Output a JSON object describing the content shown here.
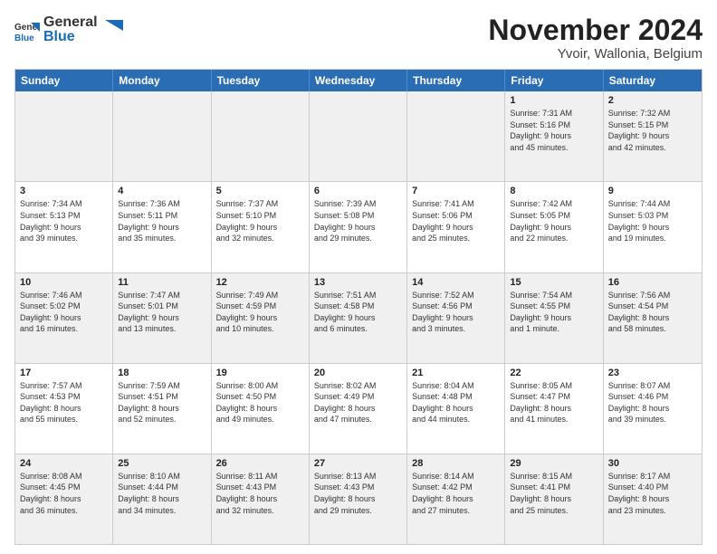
{
  "logo": {
    "general": "General",
    "blue": "Blue"
  },
  "title": "November 2024",
  "subtitle": "Yvoir, Wallonia, Belgium",
  "days_of_week": [
    "Sunday",
    "Monday",
    "Tuesday",
    "Wednesday",
    "Thursday",
    "Friday",
    "Saturday"
  ],
  "rows": [
    [
      {
        "day": "",
        "info": ""
      },
      {
        "day": "",
        "info": ""
      },
      {
        "day": "",
        "info": ""
      },
      {
        "day": "",
        "info": ""
      },
      {
        "day": "",
        "info": ""
      },
      {
        "day": "1",
        "info": "Sunrise: 7:31 AM\nSunset: 5:16 PM\nDaylight: 9 hours\nand 45 minutes."
      },
      {
        "day": "2",
        "info": "Sunrise: 7:32 AM\nSunset: 5:15 PM\nDaylight: 9 hours\nand 42 minutes."
      }
    ],
    [
      {
        "day": "3",
        "info": "Sunrise: 7:34 AM\nSunset: 5:13 PM\nDaylight: 9 hours\nand 39 minutes."
      },
      {
        "day": "4",
        "info": "Sunrise: 7:36 AM\nSunset: 5:11 PM\nDaylight: 9 hours\nand 35 minutes."
      },
      {
        "day": "5",
        "info": "Sunrise: 7:37 AM\nSunset: 5:10 PM\nDaylight: 9 hours\nand 32 minutes."
      },
      {
        "day": "6",
        "info": "Sunrise: 7:39 AM\nSunset: 5:08 PM\nDaylight: 9 hours\nand 29 minutes."
      },
      {
        "day": "7",
        "info": "Sunrise: 7:41 AM\nSunset: 5:06 PM\nDaylight: 9 hours\nand 25 minutes."
      },
      {
        "day": "8",
        "info": "Sunrise: 7:42 AM\nSunset: 5:05 PM\nDaylight: 9 hours\nand 22 minutes."
      },
      {
        "day": "9",
        "info": "Sunrise: 7:44 AM\nSunset: 5:03 PM\nDaylight: 9 hours\nand 19 minutes."
      }
    ],
    [
      {
        "day": "10",
        "info": "Sunrise: 7:46 AM\nSunset: 5:02 PM\nDaylight: 9 hours\nand 16 minutes."
      },
      {
        "day": "11",
        "info": "Sunrise: 7:47 AM\nSunset: 5:01 PM\nDaylight: 9 hours\nand 13 minutes."
      },
      {
        "day": "12",
        "info": "Sunrise: 7:49 AM\nSunset: 4:59 PM\nDaylight: 9 hours\nand 10 minutes."
      },
      {
        "day": "13",
        "info": "Sunrise: 7:51 AM\nSunset: 4:58 PM\nDaylight: 9 hours\nand 6 minutes."
      },
      {
        "day": "14",
        "info": "Sunrise: 7:52 AM\nSunset: 4:56 PM\nDaylight: 9 hours\nand 3 minutes."
      },
      {
        "day": "15",
        "info": "Sunrise: 7:54 AM\nSunset: 4:55 PM\nDaylight: 9 hours\nand 1 minute."
      },
      {
        "day": "16",
        "info": "Sunrise: 7:56 AM\nSunset: 4:54 PM\nDaylight: 8 hours\nand 58 minutes."
      }
    ],
    [
      {
        "day": "17",
        "info": "Sunrise: 7:57 AM\nSunset: 4:53 PM\nDaylight: 8 hours\nand 55 minutes."
      },
      {
        "day": "18",
        "info": "Sunrise: 7:59 AM\nSunset: 4:51 PM\nDaylight: 8 hours\nand 52 minutes."
      },
      {
        "day": "19",
        "info": "Sunrise: 8:00 AM\nSunset: 4:50 PM\nDaylight: 8 hours\nand 49 minutes."
      },
      {
        "day": "20",
        "info": "Sunrise: 8:02 AM\nSunset: 4:49 PM\nDaylight: 8 hours\nand 47 minutes."
      },
      {
        "day": "21",
        "info": "Sunrise: 8:04 AM\nSunset: 4:48 PM\nDaylight: 8 hours\nand 44 minutes."
      },
      {
        "day": "22",
        "info": "Sunrise: 8:05 AM\nSunset: 4:47 PM\nDaylight: 8 hours\nand 41 minutes."
      },
      {
        "day": "23",
        "info": "Sunrise: 8:07 AM\nSunset: 4:46 PM\nDaylight: 8 hours\nand 39 minutes."
      }
    ],
    [
      {
        "day": "24",
        "info": "Sunrise: 8:08 AM\nSunset: 4:45 PM\nDaylight: 8 hours\nand 36 minutes."
      },
      {
        "day": "25",
        "info": "Sunrise: 8:10 AM\nSunset: 4:44 PM\nDaylight: 8 hours\nand 34 minutes."
      },
      {
        "day": "26",
        "info": "Sunrise: 8:11 AM\nSunset: 4:43 PM\nDaylight: 8 hours\nand 32 minutes."
      },
      {
        "day": "27",
        "info": "Sunrise: 8:13 AM\nSunset: 4:43 PM\nDaylight: 8 hours\nand 29 minutes."
      },
      {
        "day": "28",
        "info": "Sunrise: 8:14 AM\nSunset: 4:42 PM\nDaylight: 8 hours\nand 27 minutes."
      },
      {
        "day": "29",
        "info": "Sunrise: 8:15 AM\nSunset: 4:41 PM\nDaylight: 8 hours\nand 25 minutes."
      },
      {
        "day": "30",
        "info": "Sunrise: 8:17 AM\nSunset: 4:40 PM\nDaylight: 8 hours\nand 23 minutes."
      }
    ]
  ]
}
